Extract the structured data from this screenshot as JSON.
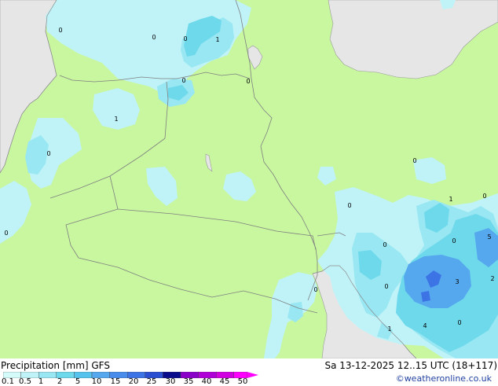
{
  "map": {
    "value_labels": [
      "0",
      "0",
      "0",
      "1",
      "0",
      "0",
      "1",
      "0",
      "0",
      "0",
      "0",
      "1",
      "0",
      "0",
      "0",
      "0",
      "3",
      "2",
      "0",
      "1",
      "4",
      "0",
      "5"
    ],
    "colors": {
      "land": "#c8f7a0",
      "sea_land_outside": "#e6e6e6",
      "precip_light": "#bff3f8",
      "precip_mid": "#98e7f2",
      "precip_high": "#6fd9ec",
      "precip_blue": "#56a8ee",
      "precip_core": "#3c74e6",
      "border": "#808080"
    }
  },
  "footer": {
    "title": "Precipitation [mm] GFS",
    "datetime": "Sa 13-12-2025 12..15 UTC (18+117)",
    "credit": "©weatheronline.co.uk",
    "scale_ticks": [
      "0.1",
      "0.5",
      "1",
      "2",
      "5",
      "10",
      "15",
      "20",
      "25",
      "30",
      "35",
      "40",
      "45",
      "50"
    ],
    "scale_colors": [
      "#d4fafa",
      "#bff3f8",
      "#98e7f2",
      "#6fd9ec",
      "#56c3ef",
      "#56a8ee",
      "#4a8cec",
      "#3c74e6",
      "#2a4fd0",
      "#0a0a8c",
      "#8a00c8",
      "#b000d8",
      "#d000e0",
      "#ff00ff"
    ]
  }
}
